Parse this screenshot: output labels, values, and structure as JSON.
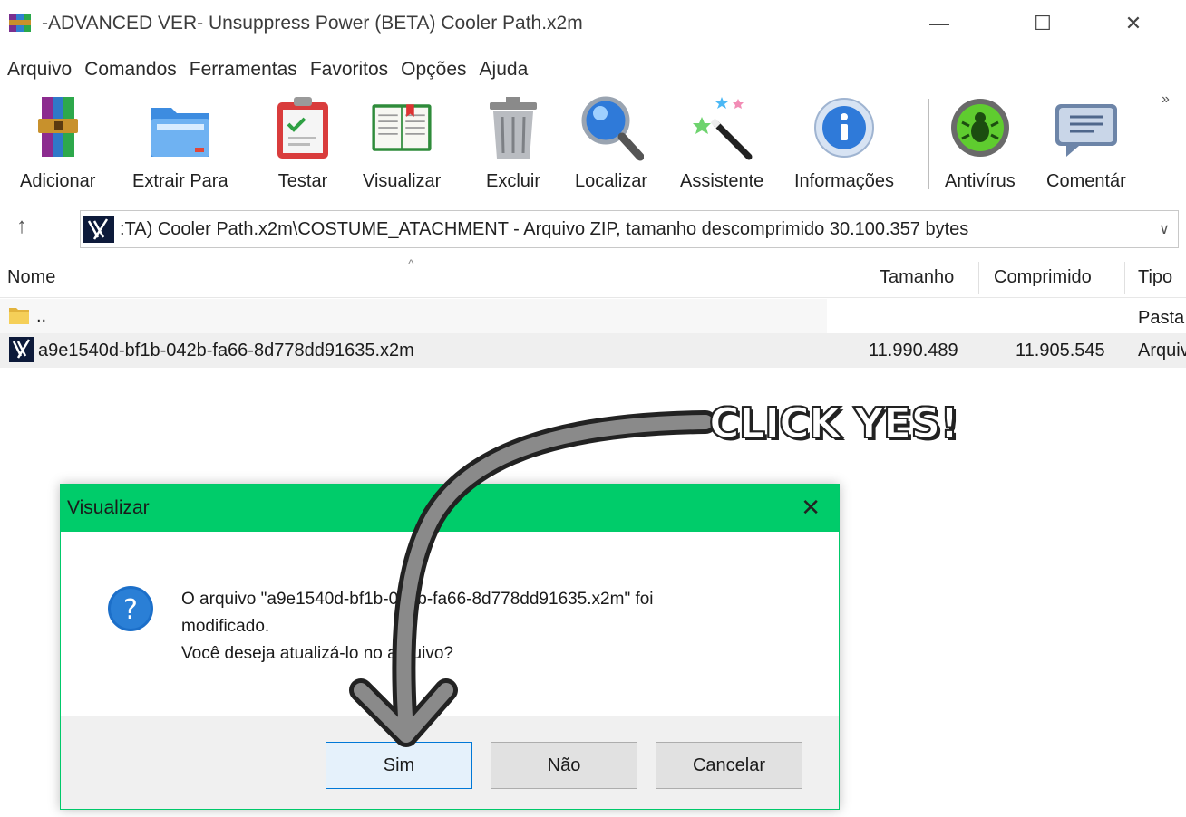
{
  "window": {
    "title": "-ADVANCED VER- Unsuppress Power (BETA) Cooler Path.x2m",
    "minimize_glyph": "—",
    "maximize_glyph": "☐",
    "close_glyph": "✕"
  },
  "menu": {
    "items": [
      {
        "label": "Arquivo"
      },
      {
        "label": "Comandos"
      },
      {
        "label": "Ferramentas"
      },
      {
        "label": "Favoritos"
      },
      {
        "label": "Opções"
      },
      {
        "label": "Ajuda"
      }
    ]
  },
  "toolbar": {
    "items": [
      {
        "label": "Adicionar",
        "icon": "archive-books-icon"
      },
      {
        "label": "Extrair Para",
        "icon": "folder-icon"
      },
      {
        "label": "Testar",
        "icon": "clipboard-check-icon"
      },
      {
        "label": "Visualizar",
        "icon": "open-book-icon"
      },
      {
        "label": "Excluir",
        "icon": "trash-icon"
      },
      {
        "label": "Localizar",
        "icon": "magnifier-icon"
      },
      {
        "label": "Assistente",
        "icon": "magic-wand-icon"
      },
      {
        "label": "Informações",
        "icon": "info-icon"
      },
      {
        "label": "Antivírus",
        "icon": "bug-icon"
      },
      {
        "label": "Comentár",
        "icon": "comment-icon"
      }
    ],
    "more_glyph": "»"
  },
  "address": {
    "up_glyph": "↑",
    "path": ":TA) Cooler Path.x2m\\COSTUME_ATACHMENT - Arquivo ZIP, tamanho descomprimido 30.100.357 bytes",
    "dropdown_glyph": "∨"
  },
  "filelist": {
    "sort_glyph": "^",
    "columns": {
      "name": "Nome",
      "size": "Tamanho",
      "packed": "Comprimido",
      "type": "Tipo"
    },
    "rows": [
      {
        "name": "..",
        "size": "",
        "packed": "",
        "type": "Pasta"
      },
      {
        "name": "a9e1540d-bf1b-042b-fa66-8d778dd91635.x2m",
        "size": "11.990.489",
        "packed": "11.905.545",
        "type": "Arquivo"
      }
    ]
  },
  "annotation": {
    "text": "CLICK YES!"
  },
  "dialog": {
    "title": "Visualizar",
    "close_glyph": "✕",
    "question_glyph": "?",
    "message_line1": "O arquivo \"a9e1540d-bf1b-042b-fa66-8d778dd91635.x2m\" foi",
    "message_line2": "modificado.",
    "message_line3": "Você deseja atualizá-lo no arquivo?",
    "buttons": {
      "yes": "Sim",
      "no": "Não",
      "cancel": "Cancelar"
    }
  },
  "colors": {
    "dialog_title_bg": "#00cc6a",
    "default_button_border": "#0078d7",
    "question_icon": "#1c6fc9"
  }
}
